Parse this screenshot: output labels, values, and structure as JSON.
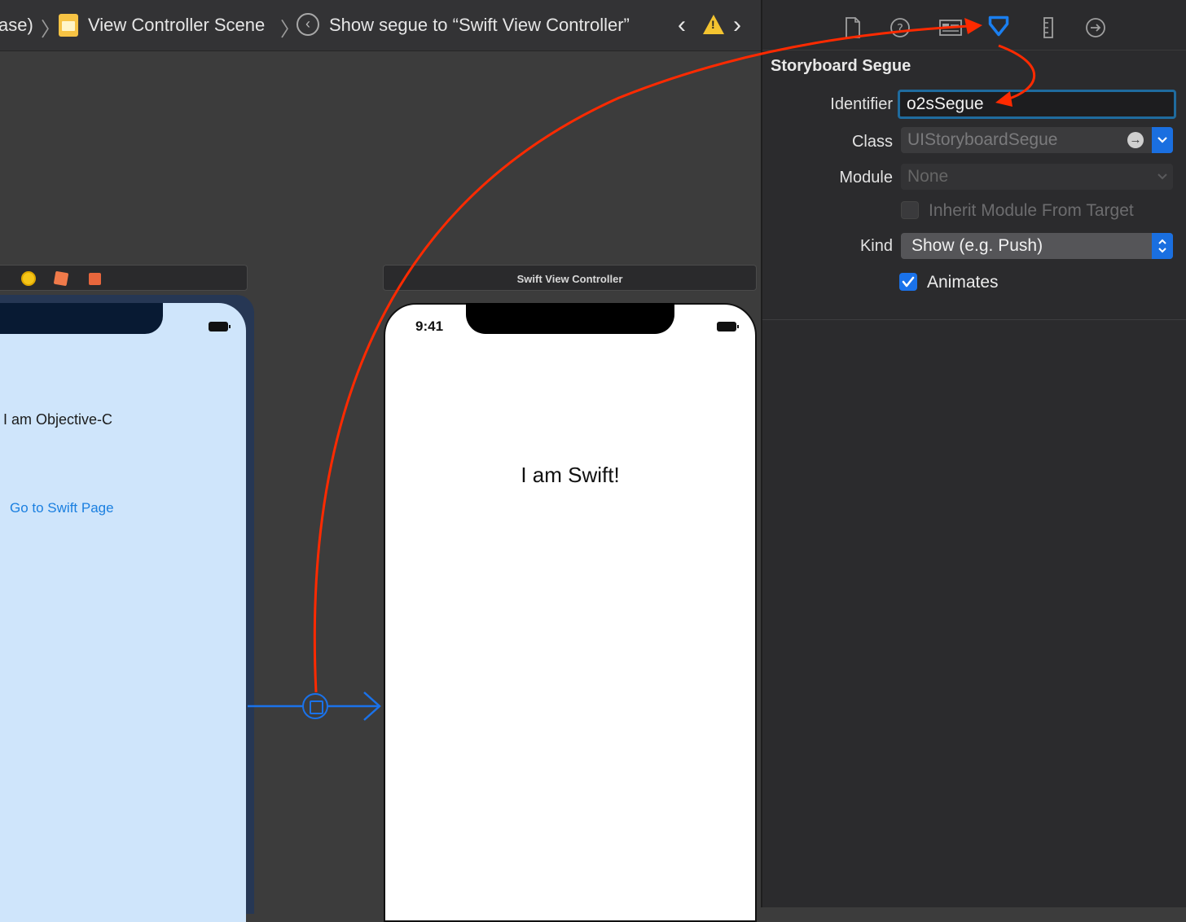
{
  "jump_bar": {
    "crumb_partial": "ase)",
    "scene": "View Controller Scene",
    "segue": "Show segue to “Swift View Controller”"
  },
  "inspector": {
    "tabs": [
      "file-icon",
      "quick-help-icon",
      "identity-icon",
      "attributes-icon",
      "size-icon",
      "connections-icon"
    ],
    "selected_tab": "attributes-icon",
    "section_title": "Storyboard Segue",
    "identifier_label": "Identifier",
    "identifier_value": "o2sSegue",
    "class_label": "Class",
    "class_value": "UIStoryboardSegue",
    "module_label": "Module",
    "module_value": "None",
    "inherit_label": "Inherit Module From Target",
    "inherit_checked": false,
    "kind_label": "Kind",
    "kind_value": "Show (e.g. Push)",
    "animates_label": "Animates",
    "animates_checked": true
  },
  "canvas": {
    "objc_scene": {
      "label": "I am Objective-C",
      "button": "Go to Swift Page"
    },
    "swift_scene": {
      "title": "Swift View Controller",
      "time": "9:41",
      "label": "I am Swift!"
    }
  },
  "colors": {
    "accent_blue": "#1a72ea",
    "annotation_red": "#ff2a00",
    "objc_background": "#cfe5fb"
  }
}
